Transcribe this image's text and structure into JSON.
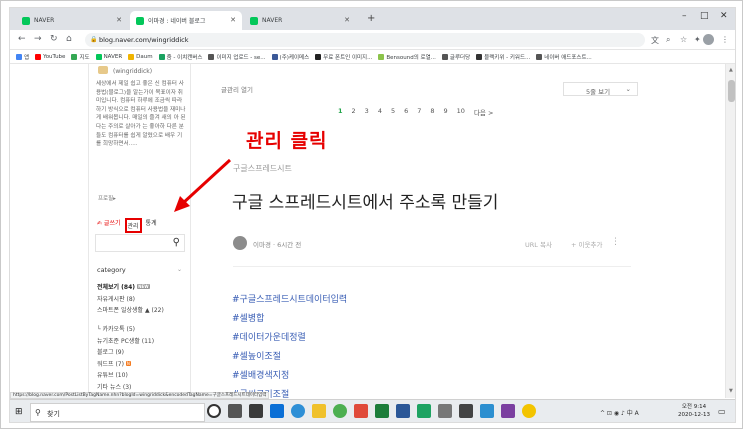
{
  "browser": {
    "tabs": [
      {
        "label": "NAVER",
        "color": "#03c75a"
      },
      {
        "label": "이마경 : 네이버 블로그",
        "color": "#03c75a"
      },
      {
        "label": "NAVER",
        "color": "#03c75a"
      }
    ],
    "new_tab": "+",
    "window_controls": [
      "–",
      "□",
      "✕"
    ],
    "url": "blog.naver.com/wingriddick",
    "bookmarks": [
      {
        "label": "앱",
        "color": "#4285f4"
      },
      {
        "label": "YouTube",
        "color": "#ff0000"
      },
      {
        "label": "지도",
        "color": "#34a853"
      },
      {
        "label": "NAVER",
        "color": "#03c75a"
      },
      {
        "label": "Daum",
        "color": "#f0b400"
      },
      {
        "label": "줌 - 이치캔버스",
        "color": "#1aa260"
      },
      {
        "label": "이미지 업로드 - se...",
        "color": "#555555"
      },
      {
        "label": "(주)케이메스",
        "color": "#3b5998"
      },
      {
        "label": "무료 폰트인 이미지...",
        "color": "#222222"
      },
      {
        "label": "Bensound의 로열...",
        "color": "#8bc34a"
      },
      {
        "label": "글루더당",
        "color": "#555555"
      },
      {
        "label": "블랙키위 - 키워드...",
        "color": "#333333"
      },
      {
        "label": "네이버 애드포스트...",
        "color": "#555555"
      }
    ],
    "status_url": "https://blog.naver.com/PostListByTagName.nhn?blogId=wingriddick&encodedTagName=구글스프레드시트데이터입력"
  },
  "sidebar": {
    "nickname": "(wingriddick)",
    "intro": "세상에서 제일 쉽고 좋은 신 컴퓨터 사용법(블로그)을 알는가이 목표이자 취미입니다. 컴퓨터 하루에 조금씩 따라하기 방식으로 컴퓨터 사용법을 재미나게 배워봅니다. 매일의 즐겨 새의 아 된다는 주의로 살아가 는 좋아하 다른 분들도 컴퓨터를 쉽게 알렸으로 배우 기를 희망하면서.....",
    "more": "프로필▸",
    "write_link": "✍ 글쓰기",
    "manage_link": "관리",
    "stats_link": "통계",
    "category_header": "category",
    "categories": [
      {
        "label": "전체보기 (84)",
        "badge": "NEW",
        "bold": true
      },
      {
        "label": "자유게시판 (8)",
        "badge": "",
        "bold": false
      },
      {
        "label": "스마트폰 일상생활 ▲ (22)",
        "badge": "",
        "bold": false
      },
      {
        "label": "└ 카카오톡 (5)",
        "badge": "",
        "bold": false
      },
      {
        "label": "뉴기초준 PC생활 (11)",
        "badge": "",
        "bold": false
      },
      {
        "label": "블로그 (9)",
        "badge": "",
        "bold": false
      },
      {
        "label": "워드프 (7)",
        "badge": "N",
        "bold": false
      },
      {
        "label": "유튜브 (10)",
        "badge": "",
        "bold": false
      },
      {
        "label": "기타 뉴스 (3)",
        "badge": "",
        "bold": false
      }
    ]
  },
  "main": {
    "list_toggle": "글관리 열기",
    "list_size": "5줄 보기",
    "pagination": [
      "1",
      "2",
      "3",
      "4",
      "5",
      "6",
      "7",
      "8",
      "9",
      "10",
      "다음 >"
    ],
    "annotation": "관리 클릭",
    "category": "구글스프레드시트",
    "title": "구글 스프레드시트에서 주소록 만들기",
    "author": "이마경 · 6시간 전",
    "url_copy": "URL 복사",
    "neighbor": "+ 이웃추가",
    "more": "⋮",
    "tags": [
      "#구글스프레드시트데이터입력",
      "#셀병합",
      "#데이터가운데정렬",
      "#셀높이조절",
      "#셀배경색지정",
      "#글씨크기조절"
    ]
  },
  "taskbar": {
    "search_placeholder": "찾기",
    "tray": "^ ⊡ ◉ ♪ 中 A",
    "time": "오전 9:14",
    "date": "2020-12-13"
  }
}
